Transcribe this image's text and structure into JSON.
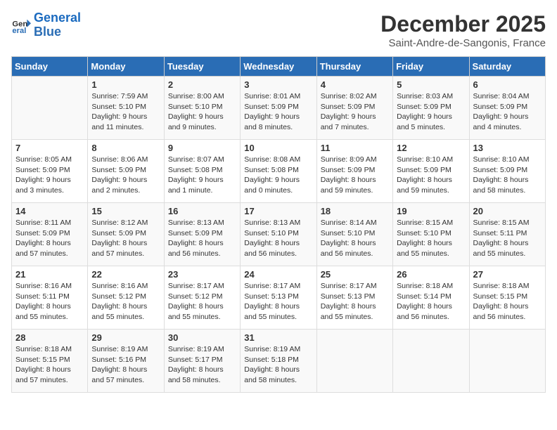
{
  "header": {
    "logo_line1": "General",
    "logo_line2": "Blue",
    "title": "December 2025",
    "subtitle": "Saint-Andre-de-Sangonis, France"
  },
  "days_of_week": [
    "Sunday",
    "Monday",
    "Tuesday",
    "Wednesday",
    "Thursday",
    "Friday",
    "Saturday"
  ],
  "weeks": [
    [
      {
        "num": "",
        "info": ""
      },
      {
        "num": "1",
        "info": "Sunrise: 7:59 AM\nSunset: 5:10 PM\nDaylight: 9 hours\nand 11 minutes."
      },
      {
        "num": "2",
        "info": "Sunrise: 8:00 AM\nSunset: 5:10 PM\nDaylight: 9 hours\nand 9 minutes."
      },
      {
        "num": "3",
        "info": "Sunrise: 8:01 AM\nSunset: 5:09 PM\nDaylight: 9 hours\nand 8 minutes."
      },
      {
        "num": "4",
        "info": "Sunrise: 8:02 AM\nSunset: 5:09 PM\nDaylight: 9 hours\nand 7 minutes."
      },
      {
        "num": "5",
        "info": "Sunrise: 8:03 AM\nSunset: 5:09 PM\nDaylight: 9 hours\nand 5 minutes."
      },
      {
        "num": "6",
        "info": "Sunrise: 8:04 AM\nSunset: 5:09 PM\nDaylight: 9 hours\nand 4 minutes."
      }
    ],
    [
      {
        "num": "7",
        "info": "Sunrise: 8:05 AM\nSunset: 5:09 PM\nDaylight: 9 hours\nand 3 minutes."
      },
      {
        "num": "8",
        "info": "Sunrise: 8:06 AM\nSunset: 5:09 PM\nDaylight: 9 hours\nand 2 minutes."
      },
      {
        "num": "9",
        "info": "Sunrise: 8:07 AM\nSunset: 5:08 PM\nDaylight: 9 hours\nand 1 minute."
      },
      {
        "num": "10",
        "info": "Sunrise: 8:08 AM\nSunset: 5:08 PM\nDaylight: 9 hours\nand 0 minutes."
      },
      {
        "num": "11",
        "info": "Sunrise: 8:09 AM\nSunset: 5:09 PM\nDaylight: 8 hours\nand 59 minutes."
      },
      {
        "num": "12",
        "info": "Sunrise: 8:10 AM\nSunset: 5:09 PM\nDaylight: 8 hours\nand 59 minutes."
      },
      {
        "num": "13",
        "info": "Sunrise: 8:10 AM\nSunset: 5:09 PM\nDaylight: 8 hours\nand 58 minutes."
      }
    ],
    [
      {
        "num": "14",
        "info": "Sunrise: 8:11 AM\nSunset: 5:09 PM\nDaylight: 8 hours\nand 57 minutes."
      },
      {
        "num": "15",
        "info": "Sunrise: 8:12 AM\nSunset: 5:09 PM\nDaylight: 8 hours\nand 57 minutes."
      },
      {
        "num": "16",
        "info": "Sunrise: 8:13 AM\nSunset: 5:09 PM\nDaylight: 8 hours\nand 56 minutes."
      },
      {
        "num": "17",
        "info": "Sunrise: 8:13 AM\nSunset: 5:10 PM\nDaylight: 8 hours\nand 56 minutes."
      },
      {
        "num": "18",
        "info": "Sunrise: 8:14 AM\nSunset: 5:10 PM\nDaylight: 8 hours\nand 56 minutes."
      },
      {
        "num": "19",
        "info": "Sunrise: 8:15 AM\nSunset: 5:10 PM\nDaylight: 8 hours\nand 55 minutes."
      },
      {
        "num": "20",
        "info": "Sunrise: 8:15 AM\nSunset: 5:11 PM\nDaylight: 8 hours\nand 55 minutes."
      }
    ],
    [
      {
        "num": "21",
        "info": "Sunrise: 8:16 AM\nSunset: 5:11 PM\nDaylight: 8 hours\nand 55 minutes."
      },
      {
        "num": "22",
        "info": "Sunrise: 8:16 AM\nSunset: 5:12 PM\nDaylight: 8 hours\nand 55 minutes."
      },
      {
        "num": "23",
        "info": "Sunrise: 8:17 AM\nSunset: 5:12 PM\nDaylight: 8 hours\nand 55 minutes."
      },
      {
        "num": "24",
        "info": "Sunrise: 8:17 AM\nSunset: 5:13 PM\nDaylight: 8 hours\nand 55 minutes."
      },
      {
        "num": "25",
        "info": "Sunrise: 8:17 AM\nSunset: 5:13 PM\nDaylight: 8 hours\nand 55 minutes."
      },
      {
        "num": "26",
        "info": "Sunrise: 8:18 AM\nSunset: 5:14 PM\nDaylight: 8 hours\nand 56 minutes."
      },
      {
        "num": "27",
        "info": "Sunrise: 8:18 AM\nSunset: 5:15 PM\nDaylight: 8 hours\nand 56 minutes."
      }
    ],
    [
      {
        "num": "28",
        "info": "Sunrise: 8:18 AM\nSunset: 5:15 PM\nDaylight: 8 hours\nand 57 minutes."
      },
      {
        "num": "29",
        "info": "Sunrise: 8:19 AM\nSunset: 5:16 PM\nDaylight: 8 hours\nand 57 minutes."
      },
      {
        "num": "30",
        "info": "Sunrise: 8:19 AM\nSunset: 5:17 PM\nDaylight: 8 hours\nand 58 minutes."
      },
      {
        "num": "31",
        "info": "Sunrise: 8:19 AM\nSunset: 5:18 PM\nDaylight: 8 hours\nand 58 minutes."
      },
      {
        "num": "",
        "info": ""
      },
      {
        "num": "",
        "info": ""
      },
      {
        "num": "",
        "info": ""
      }
    ]
  ]
}
